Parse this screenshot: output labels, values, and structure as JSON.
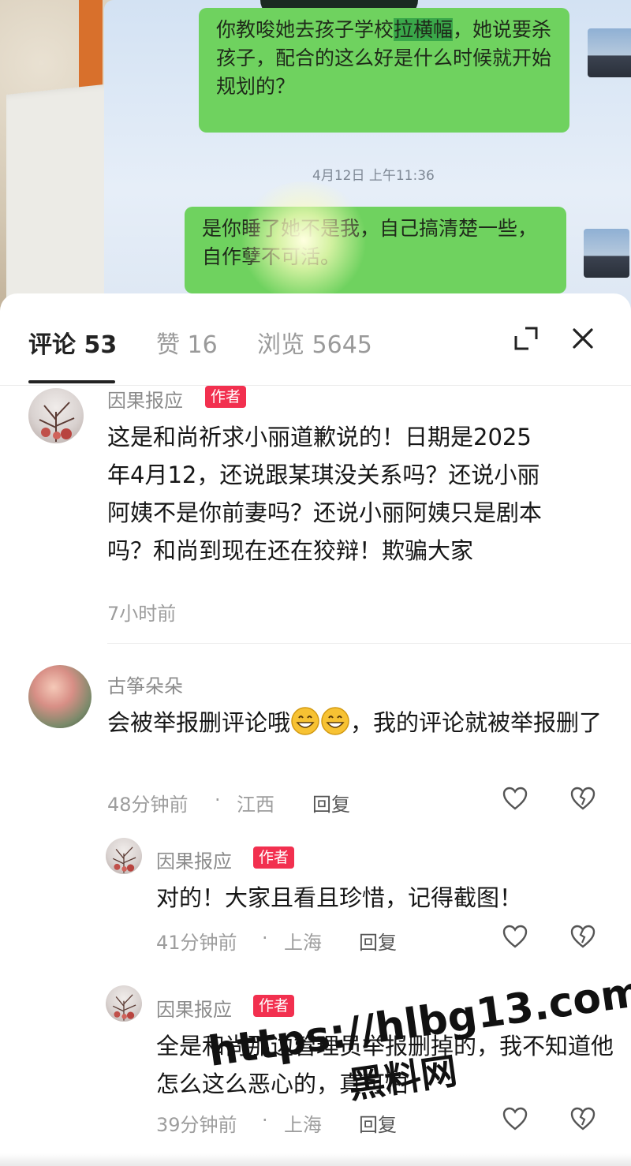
{
  "photo": {
    "bubble1": {
      "pre": "你教唆她去孩子学校",
      "hl": "拉横幅",
      "post": "，她说要杀孩子，配合的这么好是什么时候就开始规划的？"
    },
    "timestamp": "4月12日 上午11:36",
    "bubble2": "是你睡了她不是我，自己搞清楚一些，自作孽不可活。"
  },
  "tabs": {
    "comments": "评论 53",
    "likes": "赞 16",
    "views": "浏览 5645"
  },
  "icons": {
    "expand": "expand-icon",
    "close": "close-icon",
    "like": "heart-icon",
    "dislike": "broken-heart-icon"
  },
  "colors": {
    "badge": "#f2304f",
    "bubble": "#6fd25f"
  },
  "comments": [
    {
      "user": "因果报应",
      "badge": "作者",
      "text": "这是和尚祈求小丽道歉说的！日期是2025年4月12，还说跟某琪没关系吗？还说小丽阿姨不是你前妻吗？还说小丽阿姨只是剧本吗？和尚到现在还在狡辩！欺骗大家",
      "time": "7小时前"
    },
    {
      "user": "古筝朵朵",
      "text_pre": "会被举报删评论哦",
      "text_post": "，我的评论就被举报删了",
      "time": "48分钟前",
      "location": "江西",
      "reply": "回复",
      "replies": [
        {
          "user": "因果报应",
          "badge": "作者",
          "text": "对的！大家且看且珍惜，记得截图！",
          "time": "41分钟前",
          "location": "上海",
          "reply": "回复"
        },
        {
          "user": "因果报应",
          "badge": "作者",
          "text": "全是和尚那边管理员举报删掉的，我不知道他怎么这么恶心的，真可怕",
          "time": "39分钟前",
          "location": "上海",
          "reply": "回复"
        }
      ]
    }
  ],
  "meta_sep": "·",
  "watermark": {
    "url": "https://hlbg13.com",
    "name": "黑料网"
  }
}
